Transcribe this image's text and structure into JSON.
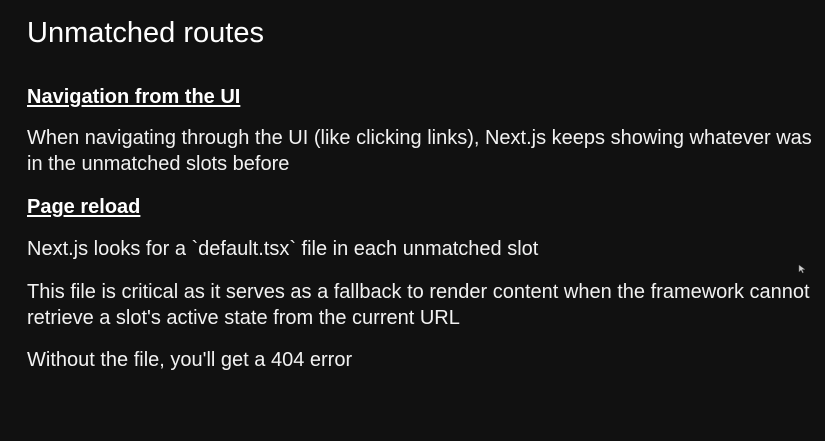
{
  "slide": {
    "title": "Unmatched routes",
    "section1": {
      "heading": "Navigation from the UI",
      "body": "When navigating through the UI (like clicking links), Next.js keeps showing whatever was in the unmatched slots before"
    },
    "section2": {
      "heading": "Page reload",
      "para1": "Next.js looks for a `default.tsx` file in each unmatched slot",
      "para2": "This file is critical as it serves as a fallback to render content when the framework cannot retrieve a slot's active state from the current URL",
      "para3": "Without the file, you'll get a 404 error"
    }
  },
  "colors": {
    "background": "#111111",
    "text": "#ffffff"
  },
  "icons": {
    "cursor": "mouse-pointer-icon"
  }
}
